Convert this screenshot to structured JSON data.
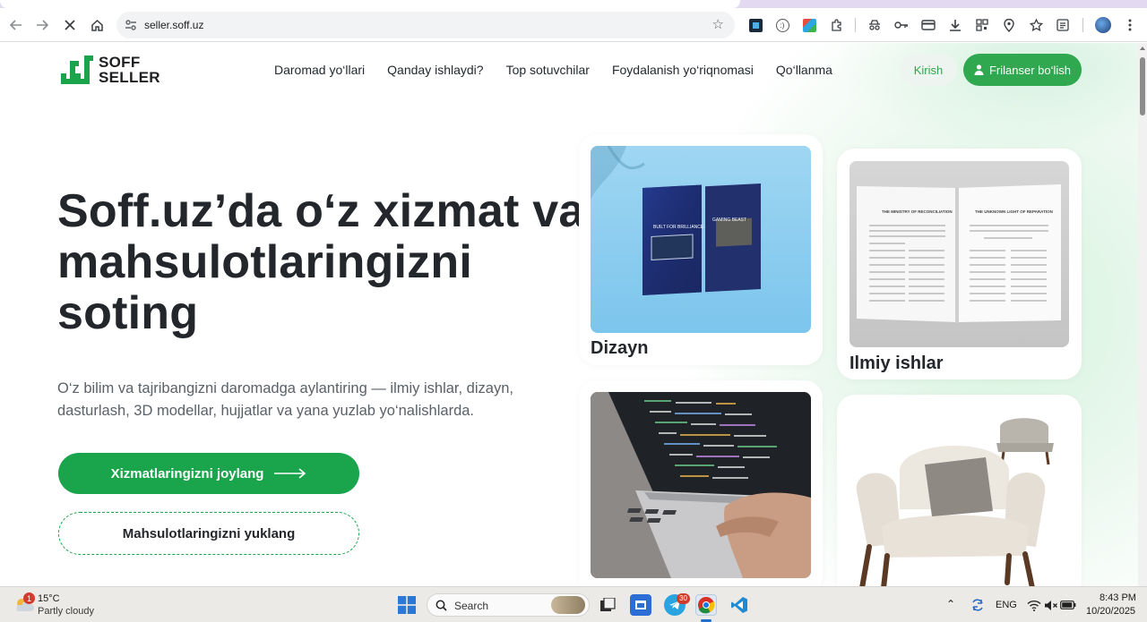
{
  "browser": {
    "url": "seller.soff.uz",
    "icons": [
      "back-icon",
      "forward-icon",
      "stop-icon",
      "home-icon",
      "site-info-icon",
      "bookmark-star-icon",
      "extension-icon",
      "password-key-icon",
      "card-icon",
      "download-icon",
      "qr-icon",
      "location-icon",
      "bookmarks-icon",
      "reading-list-icon",
      "profile-avatar",
      "menu-dots-icon"
    ]
  },
  "logo": {
    "line1": "SOFF",
    "line2": "SELLER"
  },
  "nav": {
    "items": [
      "Daromad yo‘llari",
      "Qanday ishlaydi?",
      "Top sotuvchilar",
      "Foydalanish yo‘riqnomasi",
      "Qo‘llanma"
    ]
  },
  "header": {
    "login_label": "Kirish",
    "freelancer_label": "Frilanser bo‘lish"
  },
  "hero": {
    "title": "Soff.uz’da o‘z xizmat va mahsulotlaringizni soting",
    "subtitle": "O‘z bilim va tajribangizni daromadga aylantiring — ilmiy ishlar, dizayn, dasturlash, 3D modellar, hujjatlar va yana yuzlab yo‘nalishlarda.",
    "primary_label": "Xizmatlaringizni joylang",
    "secondary_label": "Mahsulotlaringizni yuklang"
  },
  "cards": {
    "design": {
      "caption": "Dizayn",
      "brochure1": "BUILT FOR BRILLIANCE",
      "brochure2": "GAMING BEAST"
    },
    "science": {
      "caption": "Ilmiy ishlar",
      "heading_left": "THE MINISTRY OF RECONCILIATION",
      "heading_right": "THE UNKNOWN LIGHT OF REPARATION"
    },
    "coding": {
      "caption": ""
    },
    "models": {
      "caption": ""
    }
  },
  "taskbar": {
    "weather_temp": "15°C",
    "weather_cond": "Partly cloudy",
    "weather_badge": "1",
    "search_label": "Search",
    "telegram_badge": "30",
    "lang": "ENG",
    "time": "8:43 PM",
    "date": "10/20/2025"
  },
  "colors": {
    "brand_green": "#1aa44c",
    "accent_green": "#2fa84f",
    "text_dark": "#23262b"
  }
}
